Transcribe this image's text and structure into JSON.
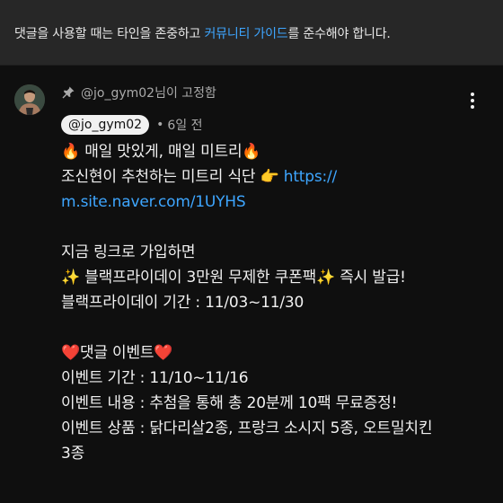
{
  "notice": {
    "before": "댓글을 사용할 때는 타인을 존중하고 ",
    "link": "커뮤니티 가이드",
    "after": "를 준수해야 합니다."
  },
  "comment": {
    "pinned_label": "@jo_gym02님이 고정함",
    "author": "@jo_gym02",
    "separator": "•",
    "time": "6일 전",
    "icons": {
      "pin": "pin-icon",
      "menu": "more-vert-icon",
      "fire": "🔥",
      "point": "👉",
      "sparkle": "✨",
      "heart": "❤️"
    },
    "lines": {
      "l1_text": "매일 맛있게, 매일 미트리",
      "l2_text": "조신현이 추천하는 미트리 식단",
      "l2_url": "https://",
      "l3_url": "m.site.naver.com/1UYHS",
      "l5": "지금 링크로 가입하면",
      "l6_text": "블랙프라이데이 3만원 무제한 쿠폰팩",
      "l6_tail": " 즉시 발급!",
      "l7": "블랙프라이데이 기간 : 11/03~11/30",
      "l9_text": "댓글 이벤트",
      "l10": "이벤트 기간 : 11/10~11/16",
      "l11": "이벤트 내용 : 추첨을 통해 총 20분께 10팩 무료증정!",
      "l12": "이벤트 상품 : 닭다리살2종, 프랑크 소시지 5종, 오트밀치킨",
      "l13": "3종"
    }
  }
}
